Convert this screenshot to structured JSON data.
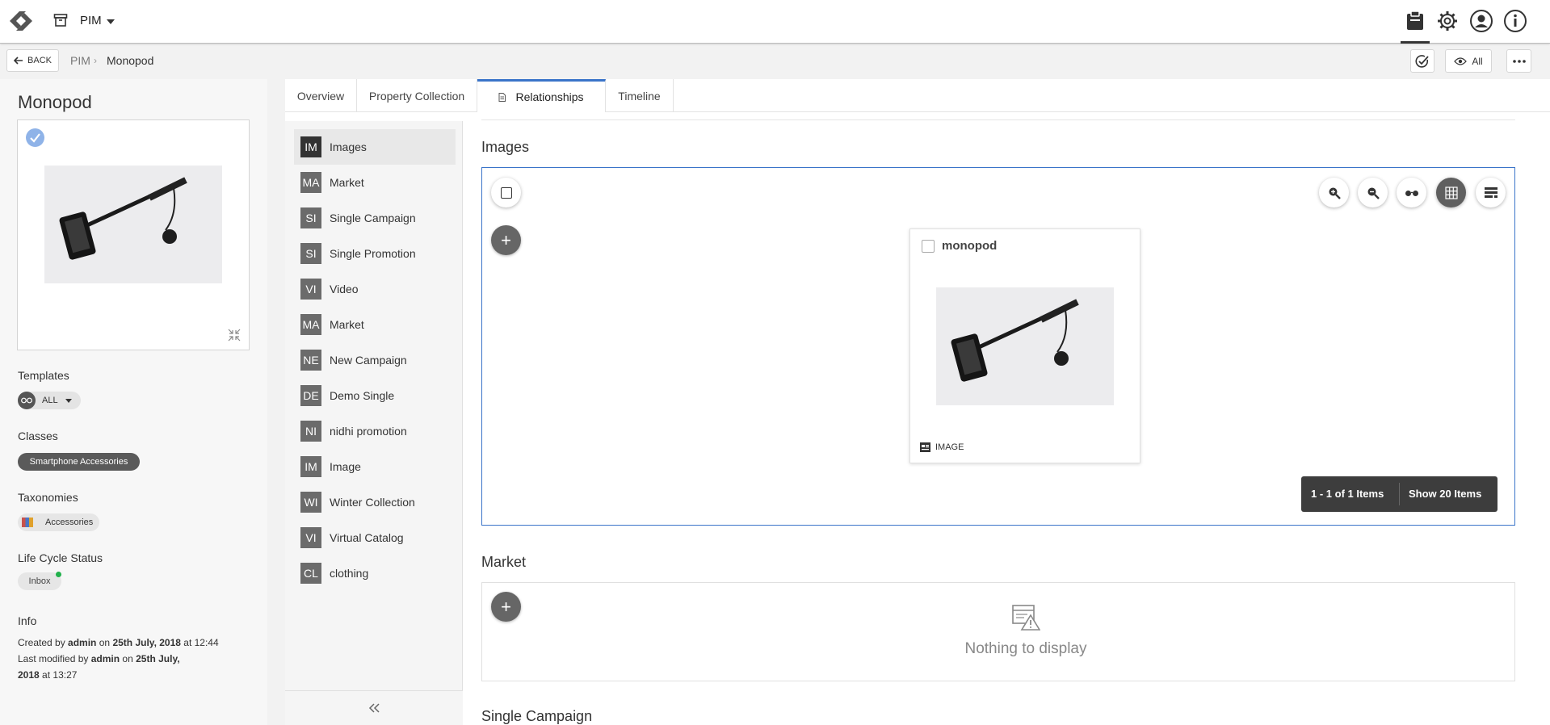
{
  "topbar": {
    "module_label": "PIM"
  },
  "breadcrumb": {
    "back_label": "BACK",
    "root": "PIM",
    "separator": "›",
    "current": "Monopod"
  },
  "toolbar_right": {
    "view_label": "All"
  },
  "entity": {
    "title": "Monopod",
    "templates_label": "Templates",
    "template_value": "ALL",
    "classes_label": "Classes",
    "class_value": "Smartphone Accessories",
    "taxonomies_label": "Taxonomies",
    "taxonomy_value": "Accessories",
    "lifecycle_label": "Life Cycle Status",
    "lifecycle_value": "Inbox",
    "lifecycle_dot_color": "#22b14c",
    "info_label": "Info",
    "created_prefix": "Created by",
    "created_user": "admin",
    "created_on": "on",
    "created_date": "25th July, 2018",
    "created_at": "at 12:44",
    "modified_prefix": "Last modified by",
    "modified_user": "admin",
    "modified_on": "on",
    "modified_date": "25th July,",
    "modified_rest": "2018",
    "modified_at": "at 13:27"
  },
  "tabs": [
    {
      "label": "Overview"
    },
    {
      "label": "Property Collection"
    },
    {
      "label": "Relationships"
    },
    {
      "label": "Timeline"
    }
  ],
  "relationships_nav": [
    {
      "badge": "IM",
      "label": "Images"
    },
    {
      "badge": "MA",
      "label": "Market"
    },
    {
      "badge": "SI",
      "label": "Single Campaign"
    },
    {
      "badge": "SI",
      "label": "Single Promotion"
    },
    {
      "badge": "VI",
      "label": "Video"
    },
    {
      "badge": "MA",
      "label": "Market"
    },
    {
      "badge": "NE",
      "label": "New Campaign"
    },
    {
      "badge": "DE",
      "label": "Demo Single"
    },
    {
      "badge": "NI",
      "label": "nidhi promotion"
    },
    {
      "badge": "IM",
      "label": "Image"
    },
    {
      "badge": "WI",
      "label": "Winter Collection"
    },
    {
      "badge": "VI",
      "label": "Virtual Catalog"
    },
    {
      "badge": "CL",
      "label": "clothing"
    }
  ],
  "images_section": {
    "title": "Images",
    "add_label": "+",
    "tile_name": "monopod",
    "tile_type": "IMAGE",
    "pager_text": "1 - 1 of 1 Items",
    "pager_button": "Show 20 Items"
  },
  "market_section": {
    "title": "Market",
    "add_label": "+",
    "empty_text": "Nothing to display"
  },
  "single_campaign_section": {
    "title": "Single Campaign"
  },
  "colors": {
    "accent": "#3a74c9",
    "badge": "#6b6b6b",
    "pager_bg": "#3d3d3d"
  }
}
